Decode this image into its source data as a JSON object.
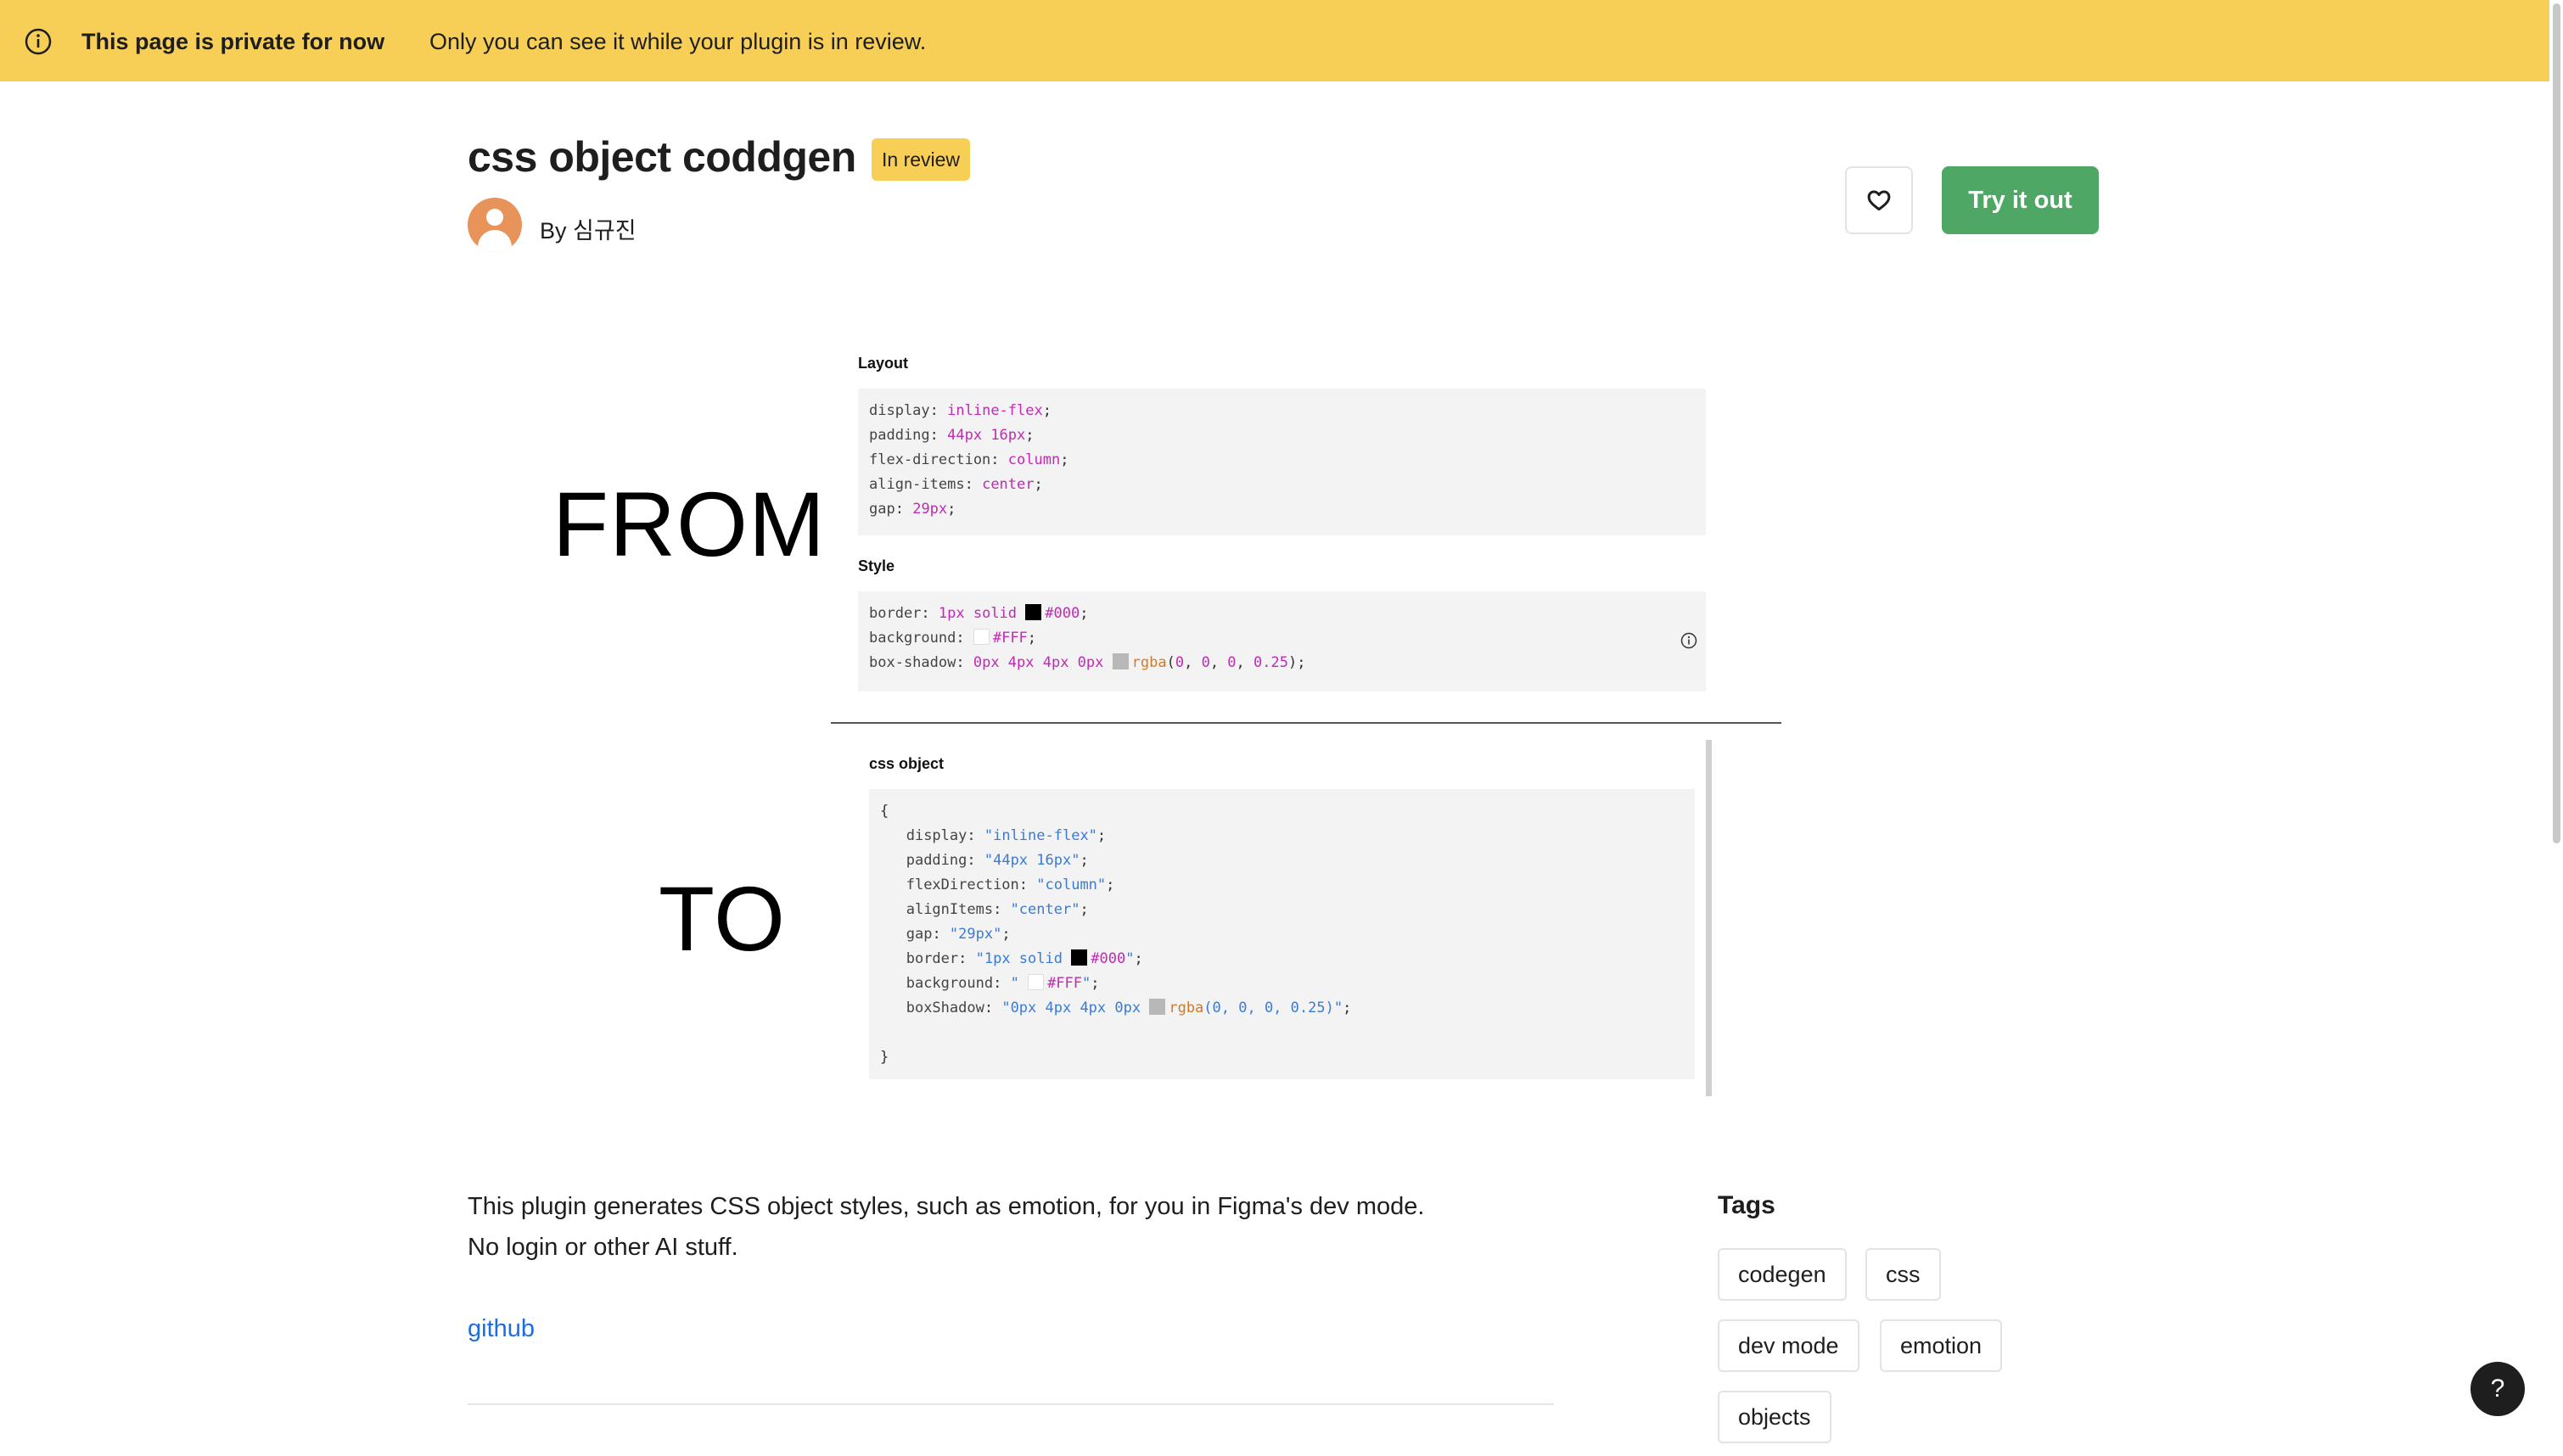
{
  "banner": {
    "title": "This page is private for now",
    "message": "Only you can see it while your plugin is in review."
  },
  "plugin": {
    "name": "css object coddgen",
    "status_badge": "In review",
    "author": "By 심규진"
  },
  "actions": {
    "try_label": "Try it out"
  },
  "cover": {
    "from_word": "FROM",
    "to_word": "TO",
    "layout_label": "Layout",
    "style_label": "Style",
    "cssobj_label": "css object"
  },
  "description": {
    "line1": "This plugin generates CSS object styles, such as emotion, for you in Figma's dev mode.",
    "line2": "No login or other AI stuff.",
    "link": "github"
  },
  "tags": {
    "title": "Tags",
    "items": [
      "codegen",
      "css",
      "dev mode",
      "emotion",
      "objects"
    ]
  },
  "help": {
    "label": "?"
  },
  "colors": {
    "banner": "#f7cf57",
    "primary_button": "#4fa765",
    "link": "#1a6fe0"
  }
}
